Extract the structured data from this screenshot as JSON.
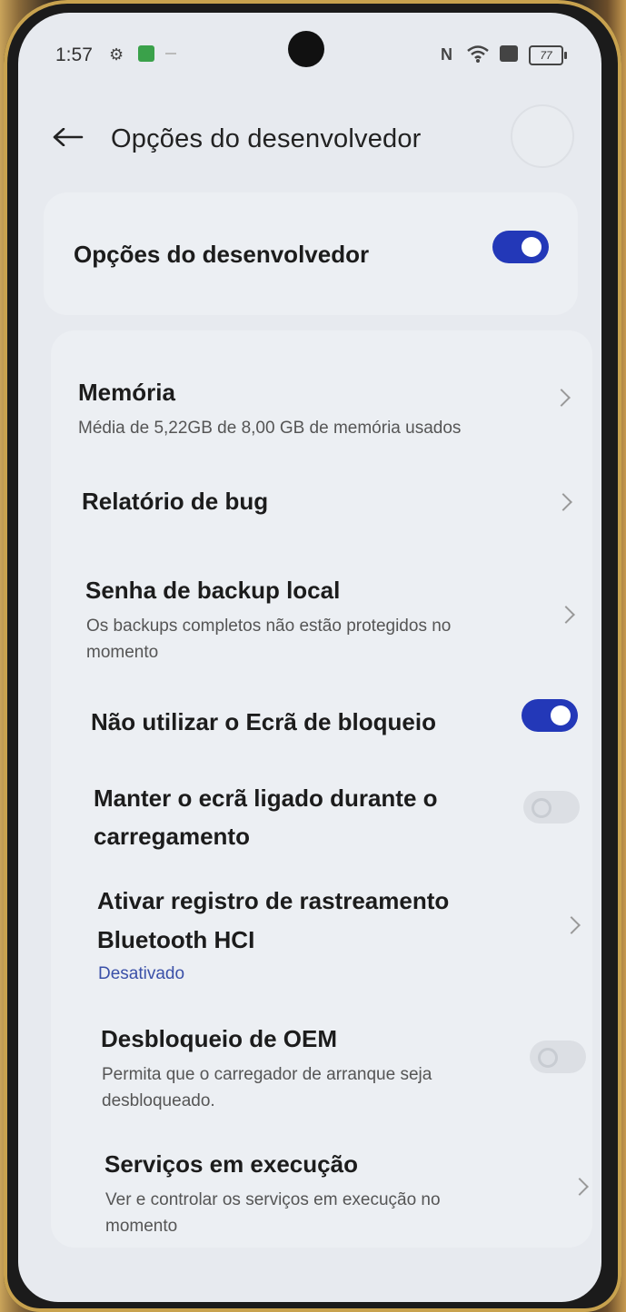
{
  "status_bar": {
    "time": "1:57",
    "battery": "77",
    "icons": [
      "settings-gear-icon",
      "green-app-icon",
      "nfc-icon",
      "wifi-icon",
      "sim-icon",
      "battery-icon"
    ]
  },
  "header": {
    "title": "Opções do desenvolvedor",
    "back_icon": "back-arrow-icon"
  },
  "master_toggle": {
    "label": "Opções do desenvolvedor",
    "enabled": true
  },
  "settings": [
    {
      "title": "Memória",
      "subtitle": "Média de 5,22GB de 8,00 GB de memória usados",
      "control": "chevron"
    },
    {
      "title": "Relatório de bug",
      "control": "chevron"
    },
    {
      "title": "Senha de backup local",
      "subtitle_lines": [
        "Os backups completos não estão protegidos no",
        "momento"
      ],
      "control": "chevron"
    },
    {
      "title": "Não utilizar o Ecrã de bloqueio",
      "control": "toggle",
      "enabled": true
    },
    {
      "title_lines": [
        "Manter o ecrã ligado durante o",
        "carregamento"
      ],
      "control": "toggle",
      "enabled": false
    },
    {
      "title_lines": [
        "Ativar registro de rastreamento",
        "Bluetooth HCI"
      ],
      "subtitle": "Desativado",
      "control": "chevron"
    },
    {
      "title": "Desbloqueio de OEM",
      "subtitle_lines": [
        "Permita que o carregador de arranque seja",
        "desbloqueado."
      ],
      "control": "toggle",
      "enabled": false
    },
    {
      "title": "Serviços em execução",
      "subtitle_lines": [
        "Ver e controlar os serviços em execução no",
        "momento"
      ],
      "control": "chevron"
    }
  ],
  "colors": {
    "accent": "#2338b8",
    "screen_bg": "#e7eaef",
    "card_bg": "#eceff3",
    "link_text": "#3a50a8"
  }
}
